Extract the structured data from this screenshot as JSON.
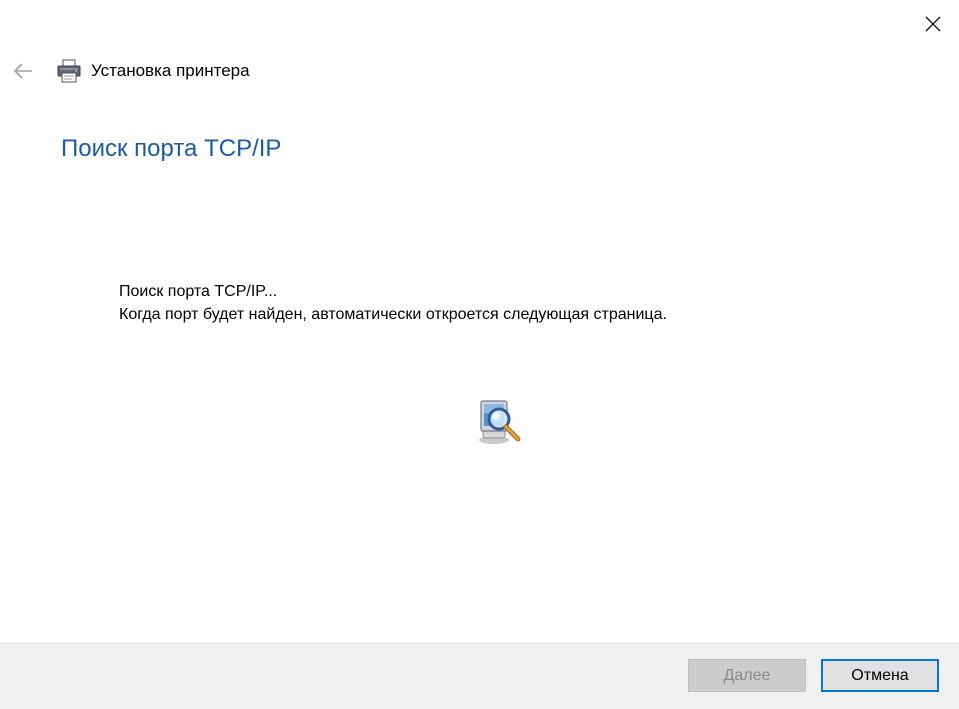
{
  "window": {
    "title": "Установка принтера"
  },
  "page": {
    "heading": "Поиск порта TCP/IP",
    "status_line1": "Поиск порта TCP/IP...",
    "status_line2": "Когда порт будет найден, автоматически откроется следующая страница."
  },
  "footer": {
    "next_label": "Далее",
    "cancel_label": "Отмена"
  },
  "icons": {
    "close": "close-icon",
    "back": "back-arrow-icon",
    "printer": "printer-icon",
    "search": "network-search-icon"
  },
  "colors": {
    "heading": "#1c5aa6",
    "accent": "#0078d7",
    "disabled_text": "#8a8a8a",
    "footer_bg": "#f0f0f0"
  }
}
